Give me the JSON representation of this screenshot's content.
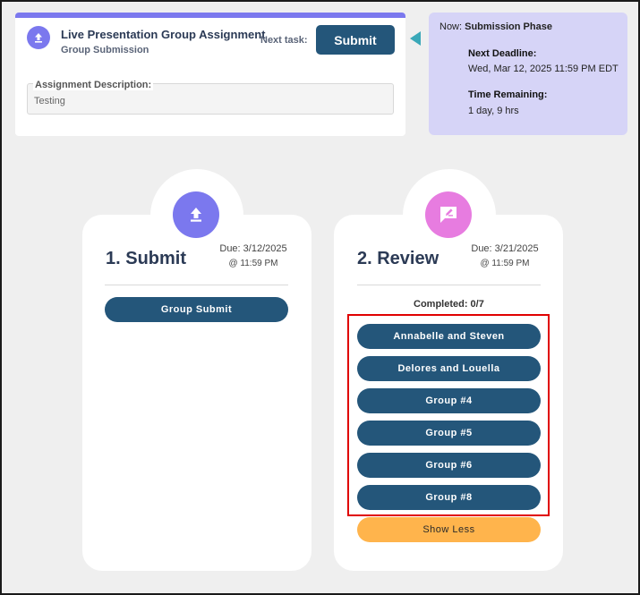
{
  "header": {
    "title": "Live Presentation Group Assignment",
    "subtitle": "Group Submission",
    "next_task_label": "Next task:",
    "submit_label": "Submit",
    "description_label": "Assignment Description:",
    "description_value": "Testing",
    "icon": "upload-icon",
    "accent_color": "#7b78ee"
  },
  "phase": {
    "now_label": "Now:",
    "now_value": "Submission Phase",
    "next_deadline_label": "Next Deadline:",
    "next_deadline_value": "Wed, Mar 12, 2025 11:59 PM EDT",
    "time_remaining_label": "Time Remaining:",
    "time_remaining_value": "1 day, 9 hrs",
    "background_color": "#d6d4f7"
  },
  "steps": [
    {
      "title": "1. Submit",
      "due_label": "Due: 3/12/2025",
      "due_time": "@ 11:59 PM",
      "icon": "upload-icon",
      "icon_color": "#7b78ee",
      "action_label": "Group Submit"
    },
    {
      "title": "2. Review",
      "due_label": "Due: 3/21/2025",
      "due_time": "@ 11:59 PM",
      "icon": "review-comment-icon",
      "icon_color": "#e77ce0",
      "completed_text": "Completed: 0/7",
      "groups": [
        "Annabelle and Steven",
        "Delores and Louella",
        "Group #4",
        "Group #5",
        "Group #6",
        "Group #8"
      ],
      "show_less_label": "Show Less"
    }
  ],
  "colors": {
    "primary_button": "#24567a",
    "show_less_button": "#ffb44c",
    "highlight_border": "#e00000"
  }
}
